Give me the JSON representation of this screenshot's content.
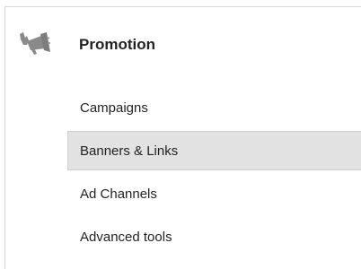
{
  "section": {
    "title": "Promotion",
    "icon": "megaphone-icon"
  },
  "nav": {
    "items": [
      {
        "label": "Campaigns",
        "selected": false
      },
      {
        "label": "Banners & Links",
        "selected": true
      },
      {
        "label": "Ad Channels",
        "selected": false
      },
      {
        "label": "Advanced tools",
        "selected": false
      }
    ]
  },
  "colors": {
    "selected_background": "#e2e2e2",
    "icon_gray": "#8a8a8a",
    "text": "#222222"
  }
}
